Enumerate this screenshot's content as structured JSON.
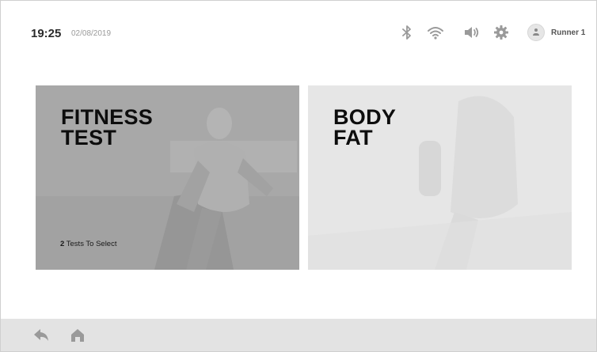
{
  "status": {
    "time": "19:25",
    "date": "02/08/2019",
    "user_name": "Runner 1",
    "icons": [
      "bluetooth-icon",
      "wifi-icon",
      "volume-icon",
      "settings-gear-icon",
      "user-avatar-icon"
    ]
  },
  "cards": [
    {
      "title_line1": "FITNESS",
      "title_line2": "TEST",
      "subtitle_count": "2",
      "subtitle_text": " Tests To Select"
    },
    {
      "title_line1": "BODY",
      "title_line2": "FAT"
    }
  ],
  "nav": {
    "icons": [
      "back-icon",
      "home-icon"
    ]
  },
  "colors": {
    "fitness_card_bg": "#a6a6a6",
    "body_card_bg": "#e4e4e4",
    "bottom_bar_bg": "#e3e3e3",
    "icon_gray": "#9a9a9a"
  }
}
